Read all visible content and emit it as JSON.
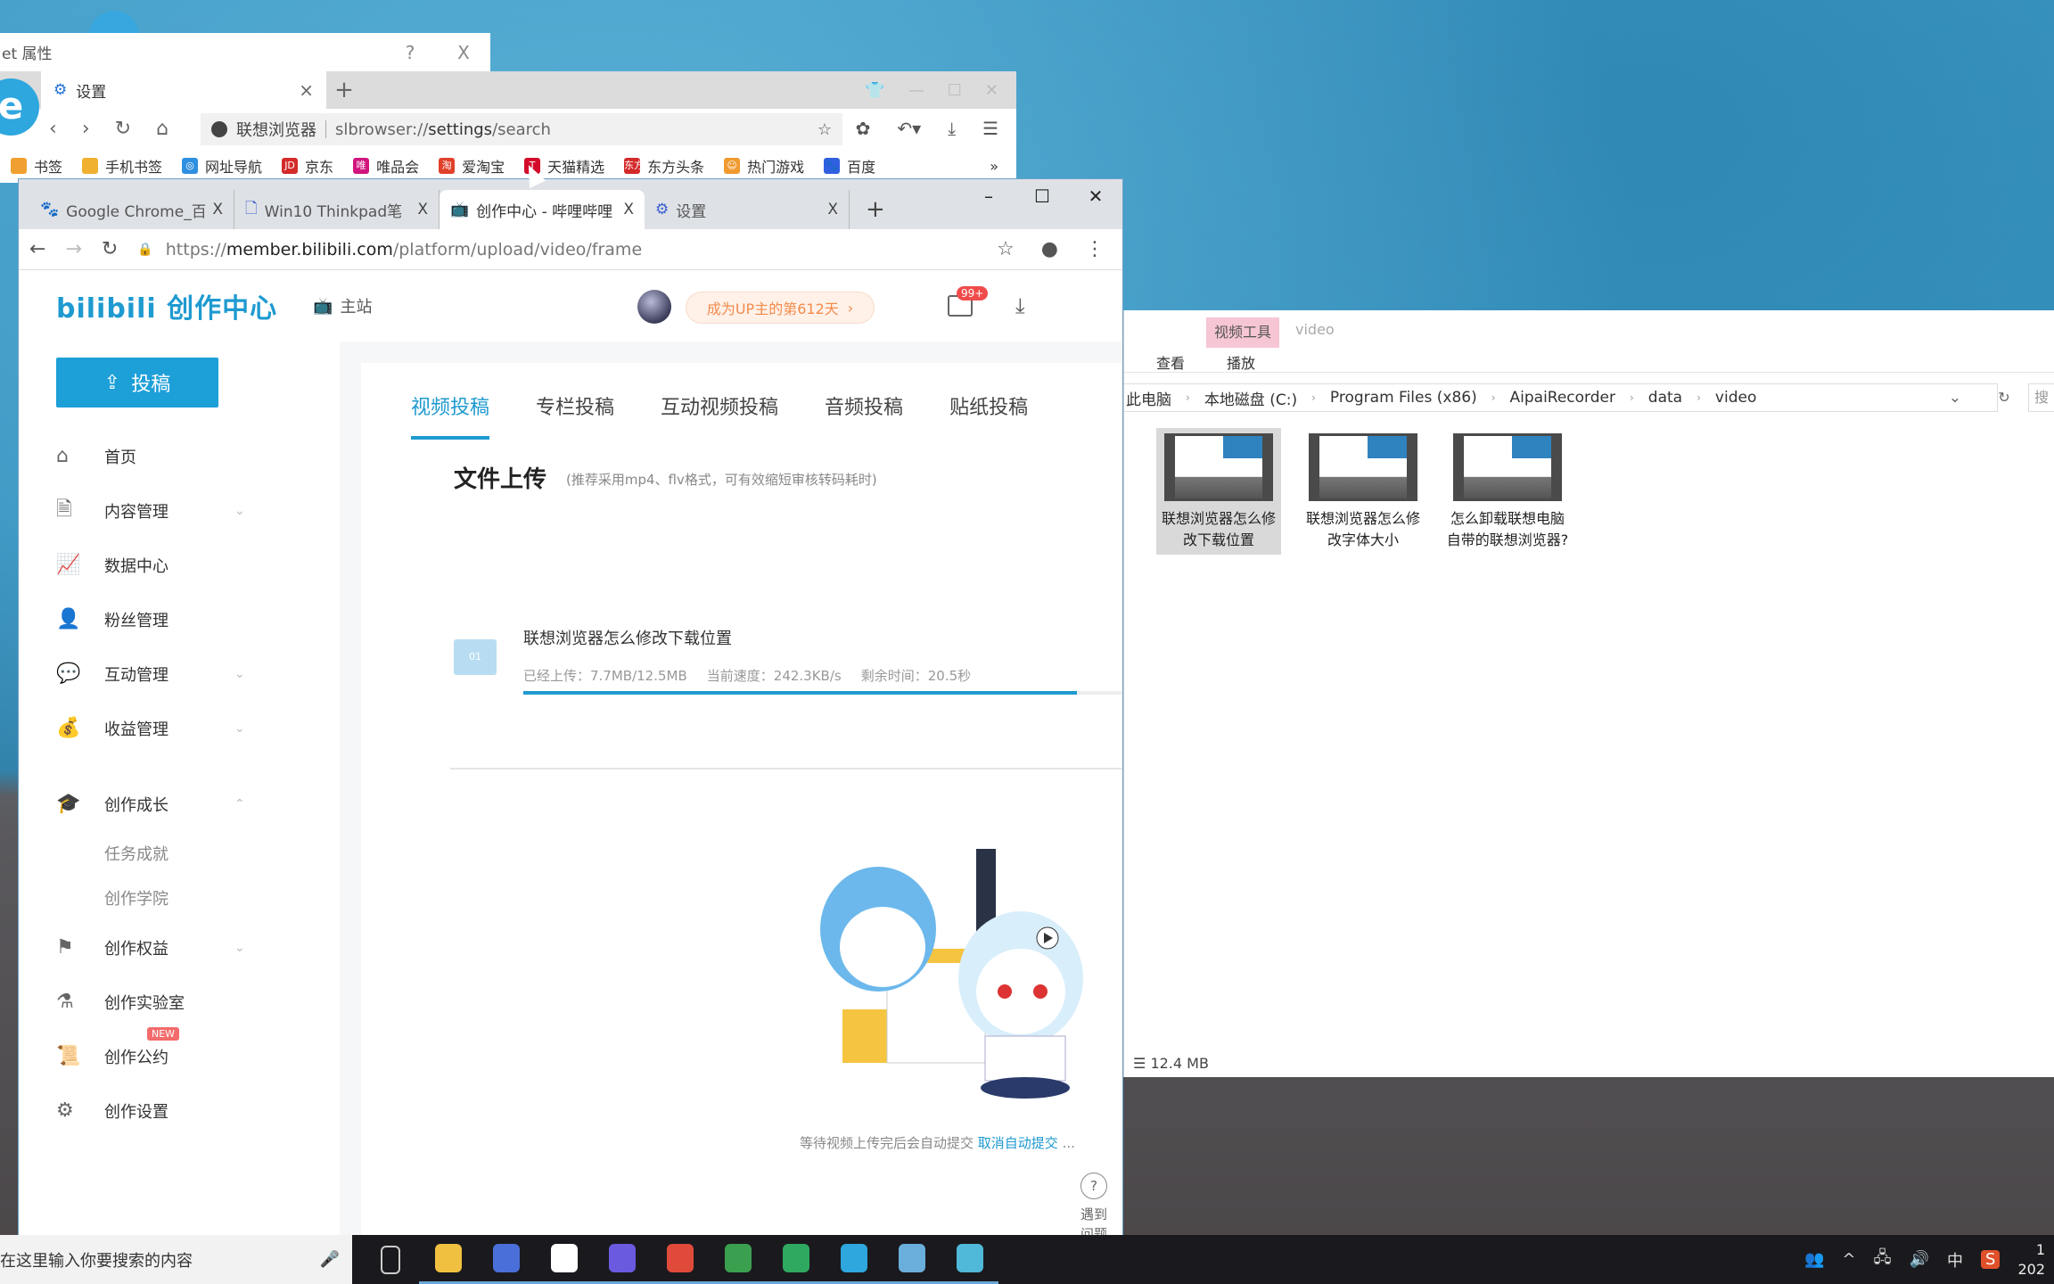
{
  "dialog": {
    "title": "et 属性",
    "help": "?",
    "close": "X"
  },
  "back_browser": {
    "logo": "e",
    "tab": {
      "icon": "gear-icon",
      "label": "设置",
      "close": "×"
    },
    "new_tab": "+",
    "window": {
      "skin": "👕",
      "minimize": "—",
      "maximize": "☐",
      "close": "✕"
    },
    "nav": {
      "back": "‹",
      "forward": "›",
      "reload": "↻",
      "home": "⌂"
    },
    "address": {
      "site_name": "联想浏览器",
      "url_prefix": "slbrowser://",
      "url_bold": "settings",
      "url_suffix": "/search"
    },
    "tools": {
      "star": "☆",
      "extensions": "✿",
      "undo": "↶▾",
      "download": "⤓",
      "menu": "☰"
    },
    "bookmarks": [
      {
        "label": "书签",
        "icon_color": "#f0a030",
        "icon_text": ""
      },
      {
        "label": "手机书签",
        "icon_color": "#f0b030",
        "icon_text": ""
      },
      {
        "label": "网址导航",
        "icon_color": "#2f8fe0",
        "icon_text": "◎"
      },
      {
        "label": "京东",
        "icon_color": "#d42a2a",
        "icon_text": "JD"
      },
      {
        "label": "唯品会",
        "icon_color": "#d1157e",
        "icon_text": "唯"
      },
      {
        "label": "爱淘宝",
        "icon_color": "#e0402a",
        "icon_text": "淘"
      },
      {
        "label": "天猫精选",
        "icon_color": "#d40a2a",
        "icon_text": "T"
      },
      {
        "label": "东方头条",
        "icon_color": "#d42a2a",
        "icon_text": "东方"
      },
      {
        "label": "热门游戏",
        "icon_color": "#f09a30",
        "icon_text": "☺"
      },
      {
        "label": "百度",
        "icon_color": "#3060e0",
        "icon_text": "🐾"
      }
    ],
    "more": "»"
  },
  "chrome": {
    "tabs": [
      {
        "icon": "paw-icon",
        "icon_glyph": "🐾",
        "label": "Google Chrome_百",
        "close": "X",
        "active": false
      },
      {
        "icon": "document-icon",
        "icon_glyph": "🗋",
        "label": "Win10 Thinkpad笔",
        "close": "X",
        "active": false
      },
      {
        "icon": "bilibili-tv-icon",
        "icon_glyph": "📺",
        "label": "创作中心 - 哔哩哔哩",
        "close": "X",
        "active": true
      },
      {
        "icon": "gear-icon",
        "icon_glyph": "⚙",
        "label": "设置",
        "close": "X",
        "active": false
      }
    ],
    "new_tab": "+",
    "window": {
      "minimize": "–",
      "maximize": "☐",
      "close": "✕"
    },
    "nav": {
      "back": "←",
      "forward": "→",
      "reload": "↻",
      "lock": "🔒"
    },
    "url": {
      "scheme": "https://",
      "host": "member.bilibili.com",
      "path": "/platform/upload/video/frame"
    },
    "star": "☆",
    "profile": "●",
    "menu": "⋮"
  },
  "bili": {
    "logo": "bilibili 创作中心",
    "main_site": "主站",
    "up_pill": "成为UP主的第612天",
    "up_pill_arrow": "›",
    "mail_badge": "99+",
    "download": "⤓",
    "post_button": "投稿",
    "menu": [
      {
        "icon": "home-icon",
        "glyph": "⌂",
        "label": "首页",
        "chevron": ""
      },
      {
        "icon": "content-icon",
        "glyph": "🗎",
        "label": "内容管理",
        "chevron": "⌄"
      },
      {
        "icon": "data-chart-icon",
        "glyph": "📈",
        "label": "数据中心",
        "chevron": ""
      },
      {
        "icon": "fans-icon",
        "glyph": "👤",
        "label": "粉丝管理",
        "chevron": ""
      },
      {
        "icon": "chat-icon",
        "glyph": "💬",
        "label": "互动管理",
        "chevron": "⌄"
      },
      {
        "icon": "money-bag-icon",
        "glyph": "💰",
        "label": "收益管理",
        "chevron": "⌄"
      }
    ],
    "growth": {
      "icon": "graduation-cap-icon",
      "glyph": "🎓",
      "label": "创作成长",
      "chevron": "⌃",
      "subs": [
        "任务成就",
        "创作学院"
      ]
    },
    "menu2": [
      {
        "icon": "flag-icon",
        "glyph": "⚑",
        "label": "创作权益",
        "chevron": "⌄",
        "badge": ""
      },
      {
        "icon": "flask-icon",
        "glyph": "⚗",
        "label": "创作实验室",
        "chevron": "",
        "badge": ""
      },
      {
        "icon": "scroll-icon",
        "glyph": "📜",
        "label": "创作公约",
        "chevron": "",
        "badge": "NEW"
      },
      {
        "icon": "settings-icon",
        "glyph": "⚙",
        "label": "创作设置",
        "chevron": "",
        "badge": ""
      }
    ],
    "tabs": [
      "视频投稿",
      "专栏投稿",
      "互动视频投稿",
      "音频投稿",
      "贴纸投稿"
    ],
    "active_tab": 0,
    "upload": {
      "title": "文件上传",
      "hint": "(推荐采用mp4、flv格式，可有效缩短审核转码耗时)",
      "file_name": "联想浏览器怎么修改下载位置",
      "uploaded": "已经上传：7.7MB/12.5MB",
      "speed": "当前速度：242.3KB/s",
      "remaining": "剩余时间：20.5秒",
      "progress_percent": 90
    },
    "wait_text": "等待视频上传完后会自动提交",
    "cancel_auto": "取消自动提交",
    "ellipsis": "...",
    "help": "遇到问题",
    "help_icon": "?"
  },
  "explorer": {
    "ribbon_context": "视频工具",
    "folder_title": "video",
    "tab_view": "查看",
    "tab_play": "播放",
    "breadcrumb": [
      "此电脑",
      "本地磁盘 (C:)",
      "Program Files (x86)",
      "AipaiRecorder",
      "data",
      "video"
    ],
    "search_placeholder": "搜",
    "files": [
      {
        "name": "联想浏览器怎么修改下载位置",
        "selected": true
      },
      {
        "name": "联想浏览器怎么修改字体大小",
        "selected": false
      },
      {
        "name": "怎么卸载联想电脑自带的联想浏览器?",
        "selected": false
      }
    ],
    "status_size": "12.4 MB"
  },
  "taskbar": {
    "search_placeholder": "在这里输入你要搜索的内容",
    "apps": [
      {
        "name": "task-view",
        "color": "transparent"
      },
      {
        "name": "file-explorer",
        "color": "#f0c040"
      },
      {
        "name": "wps",
        "color": "#4a6fd8"
      },
      {
        "name": "baidu-netdisk",
        "color": "#ffffff"
      },
      {
        "name": "screen-recorder",
        "color": "#6a5ae0"
      },
      {
        "name": "chrome",
        "color": "#e04a3a"
      },
      {
        "name": "chrome-2",
        "color": "#3aa050"
      },
      {
        "name": "wechat-tool",
        "color": "#2fa860"
      },
      {
        "name": "lenovo-browser",
        "color": "#2ea6de"
      },
      {
        "name": "notepad",
        "color": "#6aaedc"
      },
      {
        "name": "recycle",
        "color": "#50b8d8"
      }
    ],
    "tray": {
      "people": "👥",
      "chevron": "^",
      "network": "🖧",
      "volume": "🔊",
      "ime": "中",
      "sogou": "S"
    },
    "clock_time": "1",
    "clock_date": "202"
  }
}
